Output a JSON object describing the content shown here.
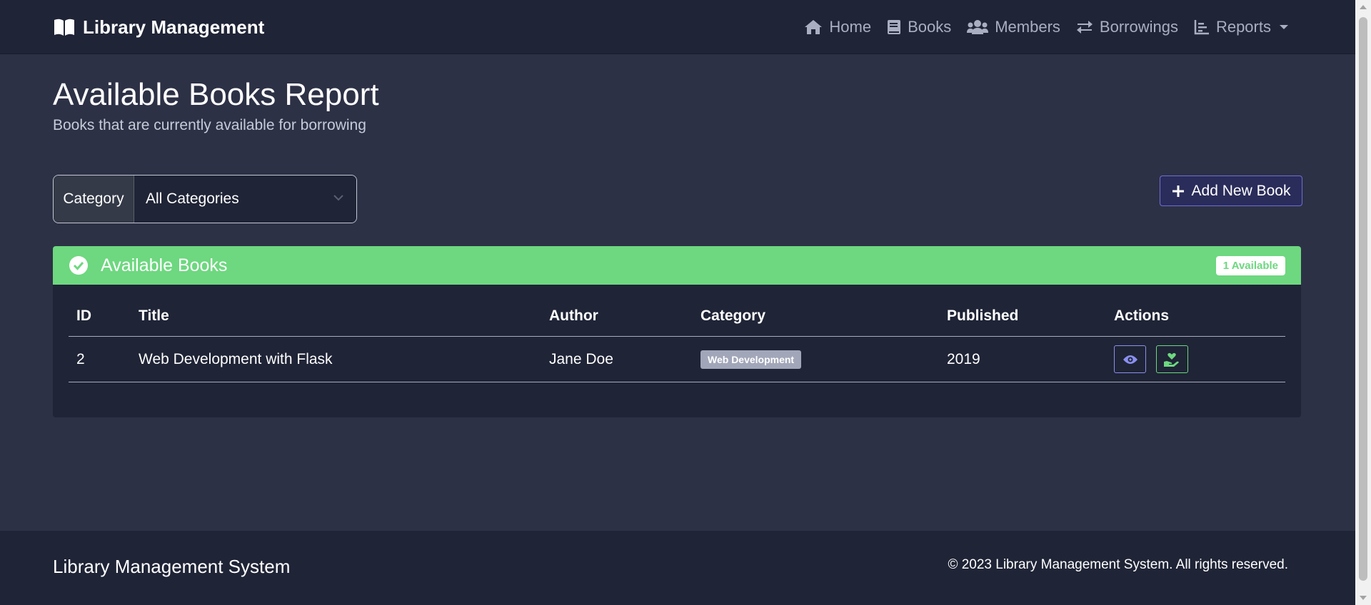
{
  "navbar": {
    "brand": "Library Management",
    "items": [
      {
        "label": "Home",
        "icon": "home-icon"
      },
      {
        "label": "Books",
        "icon": "book-icon"
      },
      {
        "label": "Members",
        "icon": "users-icon"
      },
      {
        "label": "Borrowings",
        "icon": "exchange-icon"
      },
      {
        "label": "Reports",
        "icon": "chart-icon"
      }
    ]
  },
  "page": {
    "title": "Available Books Report",
    "subtitle": "Books that are currently available for borrowing"
  },
  "filter": {
    "label": "Category",
    "selected": "All Categories"
  },
  "add_button": {
    "label": "Add New Book"
  },
  "card": {
    "title": "Available Books",
    "badge": "1 Available",
    "columns": [
      "ID",
      "Title",
      "Author",
      "Category",
      "Published",
      "Actions"
    ],
    "rows": [
      {
        "id": "2",
        "title": "Web Development with Flask",
        "author": "Jane Doe",
        "category": "Web Development",
        "published": "2019"
      }
    ]
  },
  "footer": {
    "title": "Library Management System",
    "copyright": "© 2023 Library Management System. All rights reserved."
  },
  "colors": {
    "page_bg": "#2d3146",
    "navbar_bg": "#1f2436",
    "success": "#6dd87f",
    "primary": "#8b8ff0",
    "badge_gray": "#a1a6b8"
  }
}
